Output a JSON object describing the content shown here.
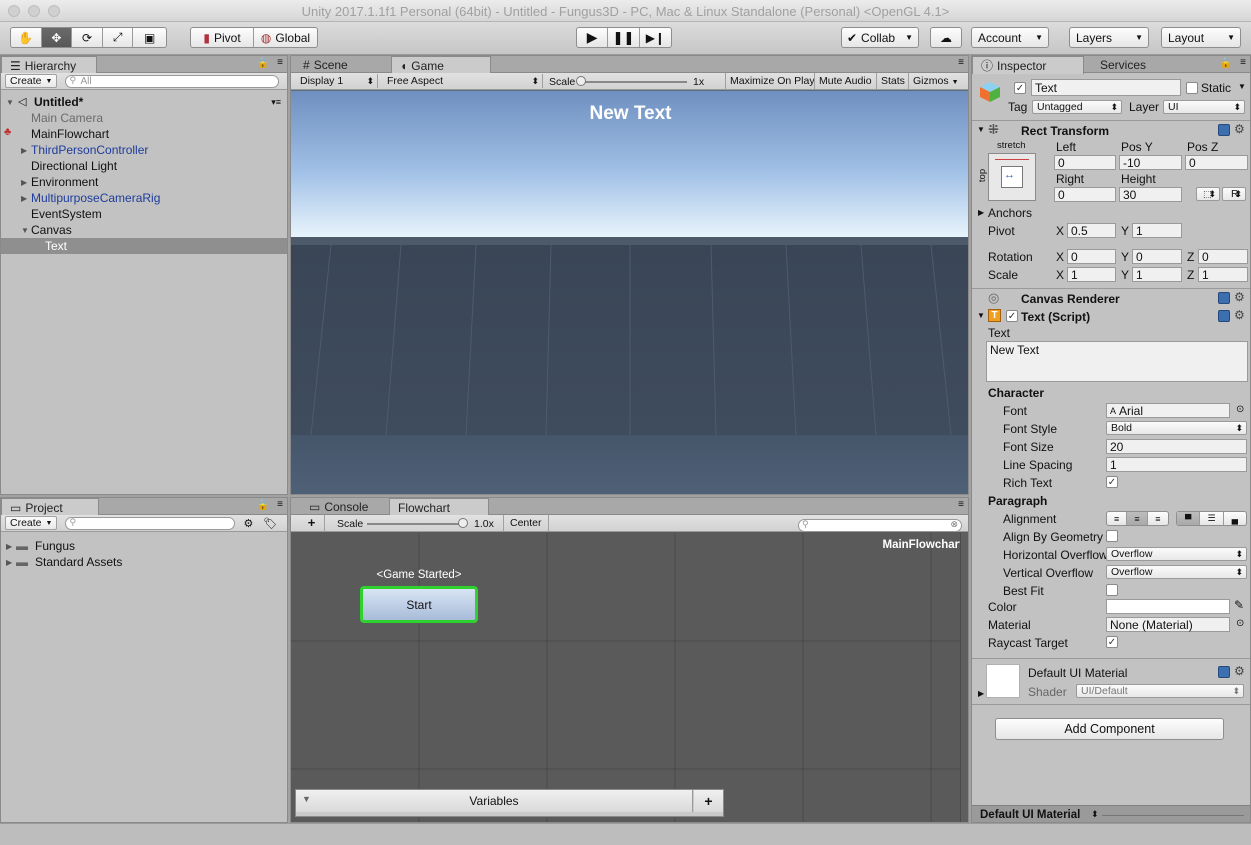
{
  "window": {
    "title": "Unity 2017.1.1f1 Personal (64bit) - Untitled - Fungus3D - PC, Mac & Linux Standalone (Personal) <OpenGL 4.1>"
  },
  "toolbar": {
    "pivot": "Pivot",
    "global": "Global",
    "collab": "Collab",
    "account": "Account",
    "layers": "Layers",
    "layout": "Layout"
  },
  "hierarchy": {
    "tab": "Hierarchy",
    "create": "Create",
    "search_placeholder": "All",
    "scene": "Untitled*",
    "items": [
      {
        "label": "Main Camera"
      },
      {
        "label": "MainFlowchart"
      },
      {
        "label": "ThirdPersonController"
      },
      {
        "label": "Directional Light"
      },
      {
        "label": "Environment"
      },
      {
        "label": "MultipurposeCameraRig"
      },
      {
        "label": "EventSystem"
      },
      {
        "label": "Canvas"
      },
      {
        "label": "Text"
      }
    ]
  },
  "game": {
    "tab_scene": "Scene",
    "tab_game": "Game",
    "display": "Display 1",
    "aspect": "Free Aspect",
    "scale_label": "Scale",
    "scale_value": "1x",
    "maximize": "Maximize On Play",
    "mute": "Mute Audio",
    "stats": "Stats",
    "gizmos": "Gizmos",
    "overlay_text": "New Text"
  },
  "project": {
    "tab": "Project",
    "create": "Create",
    "items": [
      {
        "label": "Fungus"
      },
      {
        "label": "Standard Assets"
      }
    ]
  },
  "flowchart": {
    "tab_console": "Console",
    "tab_flowchart": "Flowchart",
    "add": "+",
    "scale_label": "Scale",
    "scale_value": "1.0x",
    "center": "Center",
    "name": "MainFlowchart",
    "event_label": "<Game Started>",
    "block_label": "Start",
    "variables": "Variables",
    "variables_add": "+"
  },
  "inspector": {
    "tab": "Inspector",
    "tab_services": "Services",
    "object_name": "Text",
    "static_label": "Static",
    "tag_label": "Tag",
    "tag_value": "Untagged",
    "layer_label": "Layer",
    "layer_value": "UI",
    "rect_transform": {
      "title": "Rect Transform",
      "anchor_h": "stretch",
      "anchor_v": "top",
      "left_label": "Left",
      "posy_label": "Pos Y",
      "posz_label": "Pos Z",
      "left": "0",
      "posy": "-10",
      "posz": "0",
      "right_label": "Right",
      "height_label": "Height",
      "right": "0",
      "height": "30",
      "r_btn": "R",
      "anchors": "Anchors",
      "pivot_label": "Pivot",
      "pivot_x": "0.5",
      "pivot_y": "1",
      "rotation_label": "Rotation",
      "rot_x": "0",
      "rot_y": "0",
      "rot_z": "0",
      "scale_label": "Scale",
      "scale_x": "1",
      "scale_y": "1",
      "scale_z": "1",
      "x": "X",
      "y": "Y",
      "z": "Z"
    },
    "canvas_renderer": "Canvas Renderer",
    "text_script": {
      "title": "Text (Script)",
      "text_label": "Text",
      "text_value": "New Text",
      "character": "Character",
      "font_label": "Font",
      "font_value": "Arial",
      "font_style_label": "Font Style",
      "font_style_value": "Bold",
      "font_size_label": "Font Size",
      "font_size_value": "20",
      "line_spacing_label": "Line Spacing",
      "line_spacing_value": "1",
      "rich_text_label": "Rich Text",
      "paragraph": "Paragraph",
      "alignment_label": "Alignment",
      "align_geom_label": "Align By Geometry",
      "h_overflow_label": "Horizontal Overflow",
      "h_overflow_value": "Overflow",
      "v_overflow_label": "Vertical Overflow",
      "v_overflow_value": "Overflow",
      "best_fit_label": "Best Fit",
      "color_label": "Color",
      "material_label": "Material",
      "material_value": "None (Material)",
      "raycast_label": "Raycast Target"
    },
    "material": {
      "title": "Default UI Material",
      "shader_label": "Shader",
      "shader_value": "UI/Default"
    },
    "add_component": "Add Component",
    "footer": "Default UI Material"
  }
}
